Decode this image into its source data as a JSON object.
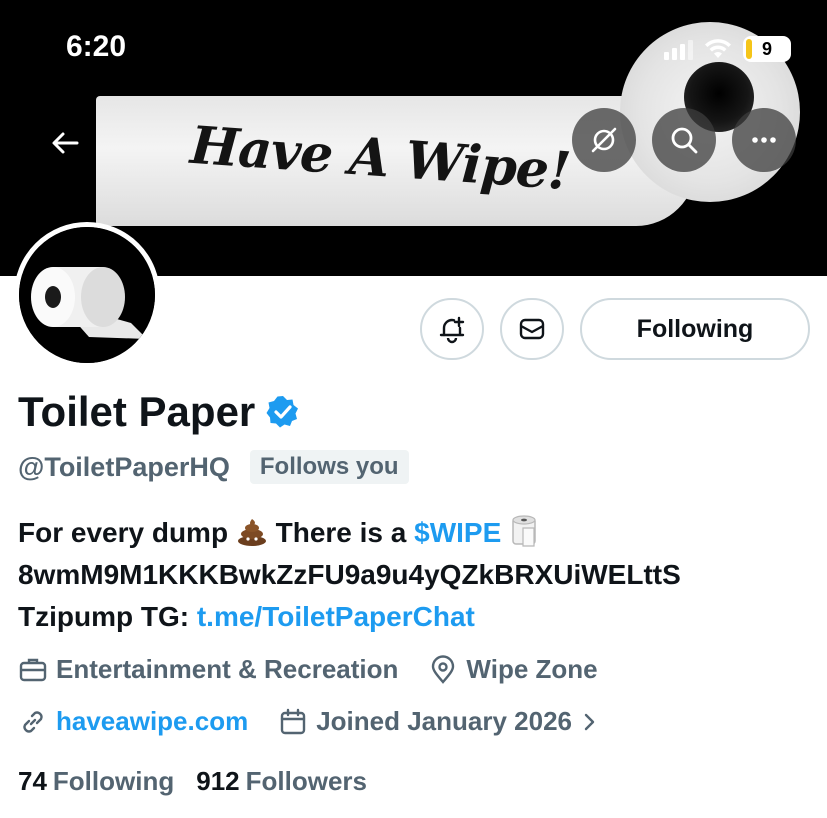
{
  "status_bar": {
    "time": "6:20",
    "battery": "9"
  },
  "banner": {
    "text": "Have A Wipe!"
  },
  "header": {
    "back_icon": "arrow-left-icon",
    "mute_icon": "hidden-eye-icon",
    "search_icon": "search-icon",
    "more_icon": "ellipsis-icon"
  },
  "actions": {
    "notify_icon": "bell-plus-icon",
    "message_icon": "mail-icon",
    "following_label": "Following"
  },
  "profile": {
    "name": "Toilet Paper",
    "verified": true,
    "handle": "@ToiletPaperHQ",
    "follows_you": "Follows you"
  },
  "bio": {
    "line1_prefix": "For every dump",
    "line1_middle": "There is a",
    "line1_cashtag": "$WIPE",
    "line2": "8wmM9M1KKKBwkZzFU9a9u4yQZkBRXUiWELttS",
    "line3_prefix": "Tzipump TG:",
    "line3_link": "t.me/ToiletPaperChat"
  },
  "meta": {
    "category": "Entertainment & Recreation",
    "location": "Wipe Zone",
    "website": "haveawipe.com",
    "joined": "Joined January 2026"
  },
  "counts": {
    "following_num": "74",
    "following_label": "Following",
    "followers_num": "912",
    "followers_label": "Followers"
  },
  "colors": {
    "accent": "#1d9bf0",
    "secondary_text": "#536471",
    "primary_text": "#0f1419"
  }
}
